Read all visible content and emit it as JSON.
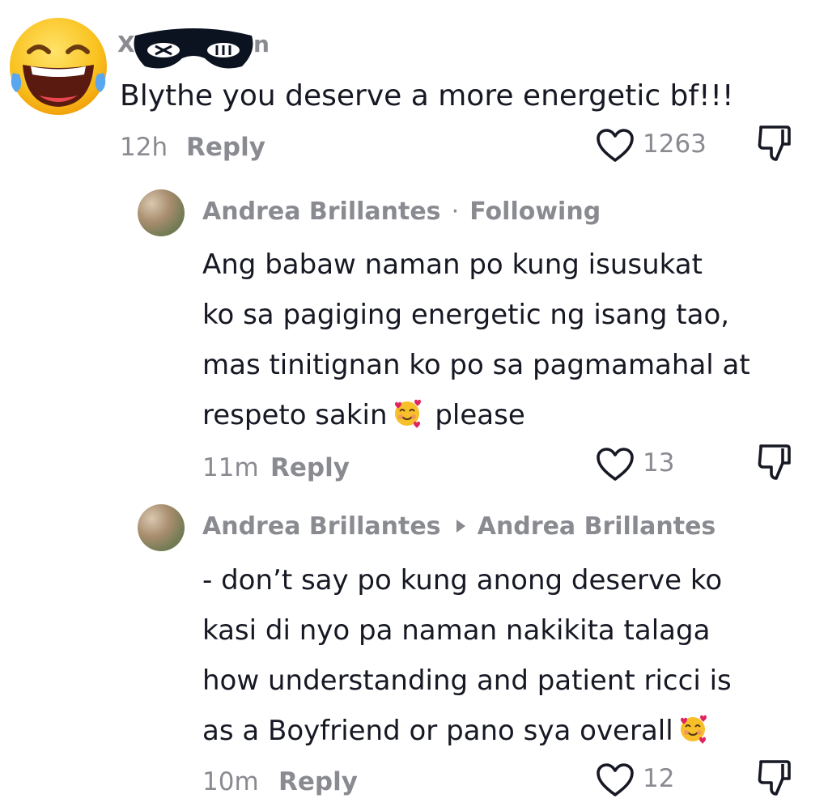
{
  "comment": {
    "username_redacted": "X",
    "username_suffix": "n",
    "text": "Blythe you deserve a more energetic bf!!!",
    "time": "12h",
    "reply_label": "Reply",
    "likes": "1263"
  },
  "replies": [
    {
      "author": "Andrea Brillantes",
      "separator": "·",
      "tag": "Following",
      "lines": [
        "Ang babaw naman po kung isusukat",
        "ko sa pagiging energetic ng isang tao,",
        "mas tinitignan ko po sa pagmamahal at"
      ],
      "last_line_before": "respeto sakin",
      "last_line_after": " please",
      "time": "11m",
      "reply_label": "Reply",
      "likes": "13"
    },
    {
      "author": "Andrea Brillantes",
      "reply_to": "Andrea Brillantes",
      "lines": [
        "- don’t say po kung anong deserve ko",
        "kasi di nyo pa naman nakikita talaga",
        "how understanding and patient ricci is"
      ],
      "last_line_before": "as a Boyfriend or pano sya overall",
      "time": "10m",
      "reply_label": "Reply",
      "likes": "12"
    }
  ],
  "icons": {
    "commenter_avatar": "laughing-tears-emoji",
    "mask": "redaction-mask",
    "like": "heart-outline-icon",
    "dislike": "thumbs-down-icon",
    "inline_emoji": "smiling-face-with-hearts-emoji"
  },
  "colors": {
    "text": "#161823",
    "muted": "#8a8b91",
    "mask": "#0b1220"
  }
}
